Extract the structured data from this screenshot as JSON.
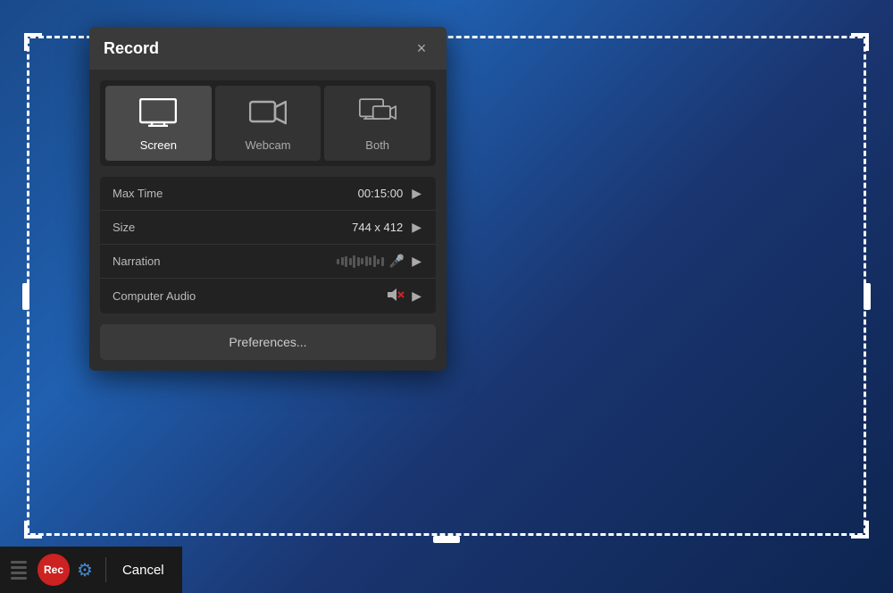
{
  "dialog": {
    "title": "Record",
    "close_label": "×"
  },
  "modes": [
    {
      "id": "screen",
      "label": "Screen",
      "active": true
    },
    {
      "id": "webcam",
      "label": "Webcam",
      "active": false
    },
    {
      "id": "both",
      "label": "Both",
      "active": false
    }
  ],
  "settings": [
    {
      "id": "max-time",
      "label": "Max Time",
      "value": "00:15:00",
      "has_chevron": true
    },
    {
      "id": "size",
      "label": "Size",
      "value": "744 x 412",
      "has_chevron": true
    },
    {
      "id": "narration",
      "label": "Narration",
      "value": "",
      "has_meter": true,
      "has_mic": true,
      "has_chevron": true
    },
    {
      "id": "computer-audio",
      "label": "Computer Audio",
      "value": "",
      "has_mute": true,
      "has_chevron": true
    }
  ],
  "preferences_label": "Preferences...",
  "toolbar": {
    "rec_label": "Rec",
    "cancel_label": "Cancel"
  }
}
